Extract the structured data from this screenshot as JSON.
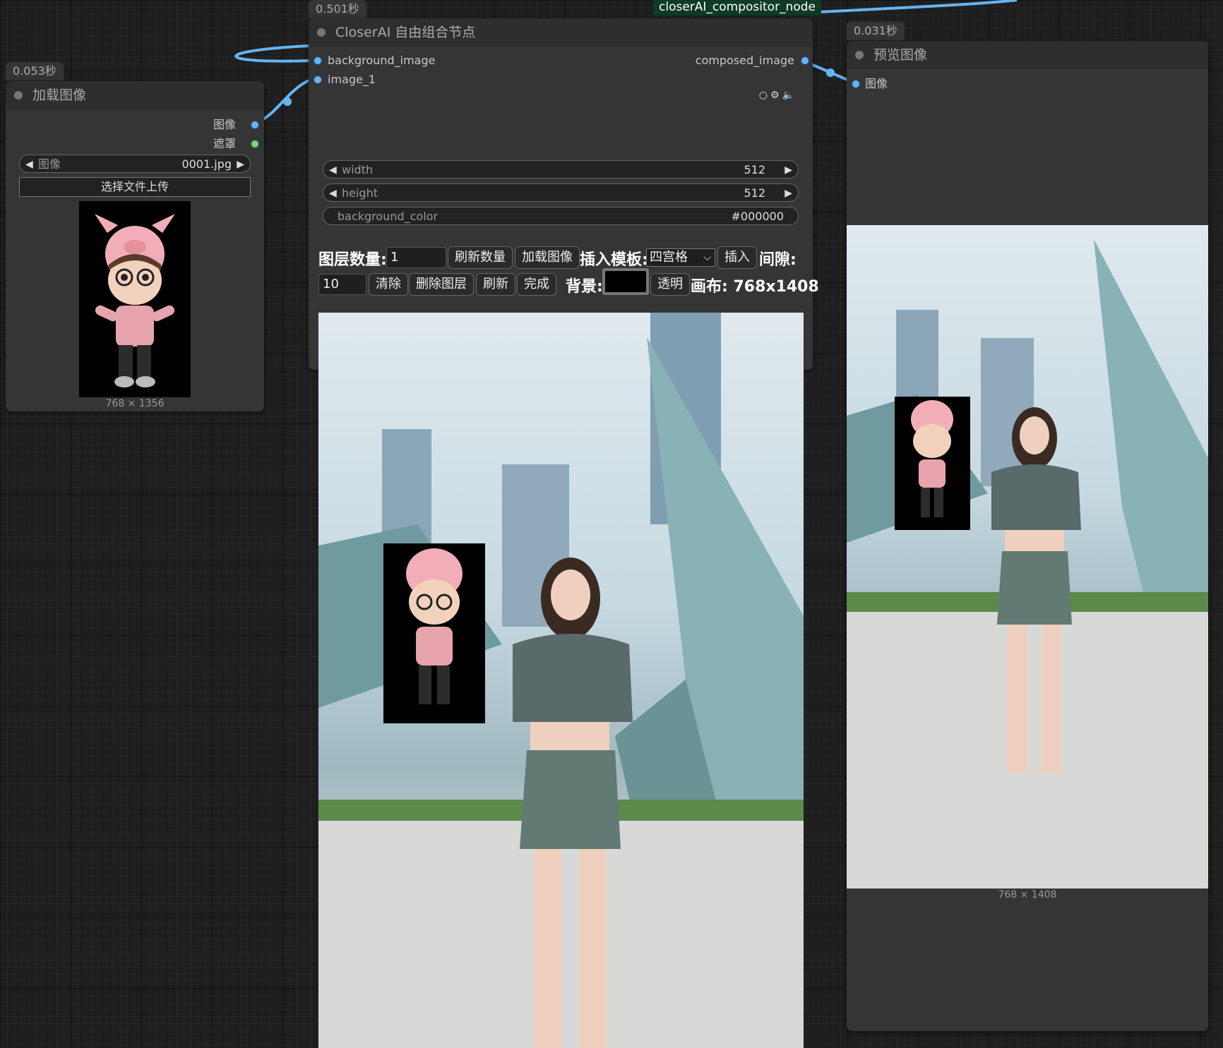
{
  "wire_label": "closerAI_compositor_node",
  "load_node": {
    "timing": "0.053秒",
    "title": "加载图像",
    "outputs": [
      "图像",
      "遮罩"
    ],
    "image_widget": {
      "label": "图像",
      "value": "0001.jpg"
    },
    "upload_button": "选择文件上传",
    "caption": "768 × 1356"
  },
  "compositor_node": {
    "timing": "0.501秒",
    "title": "CloserAI 自由组合节点",
    "inputs": [
      "background_image",
      "image_1"
    ],
    "output": "composed_image",
    "icons": [
      "circle-icon",
      "gear-icon",
      "speaker-icon"
    ],
    "widgets": {
      "width": {
        "label": "width",
        "value": "512"
      },
      "height": {
        "label": "height",
        "value": "512"
      },
      "background_color": {
        "label": "background_color",
        "value": "#000000"
      }
    },
    "toolbar": {
      "layer_count_label": "图层数量:",
      "layer_count_value": "1",
      "refresh_count": "刷新数量",
      "load_image": "加载图像",
      "insert_template_label": "插入模板:",
      "template_selected": "四宫格",
      "insert": "插入",
      "spacing_label": "间隙:",
      "spacing_value": "10",
      "clear": "清除",
      "delete_layer": "删除图层",
      "refresh": "刷新",
      "done": "完成",
      "bg_label": "背景:",
      "bg_swatch": "#000000",
      "transparent": "透明",
      "canvas_label": "画布: 768x1408"
    }
  },
  "preview_node": {
    "timing": "0.031秒",
    "title": "预览图像",
    "input": "图像",
    "caption": "768 × 1408"
  },
  "colors": {
    "wire": "#64b5f6",
    "node_bg": "#353535",
    "title_bg": "#2e2e2e",
    "canvas_bg": "#1e1e1e",
    "wire_label_bg": "#0e3b26"
  }
}
